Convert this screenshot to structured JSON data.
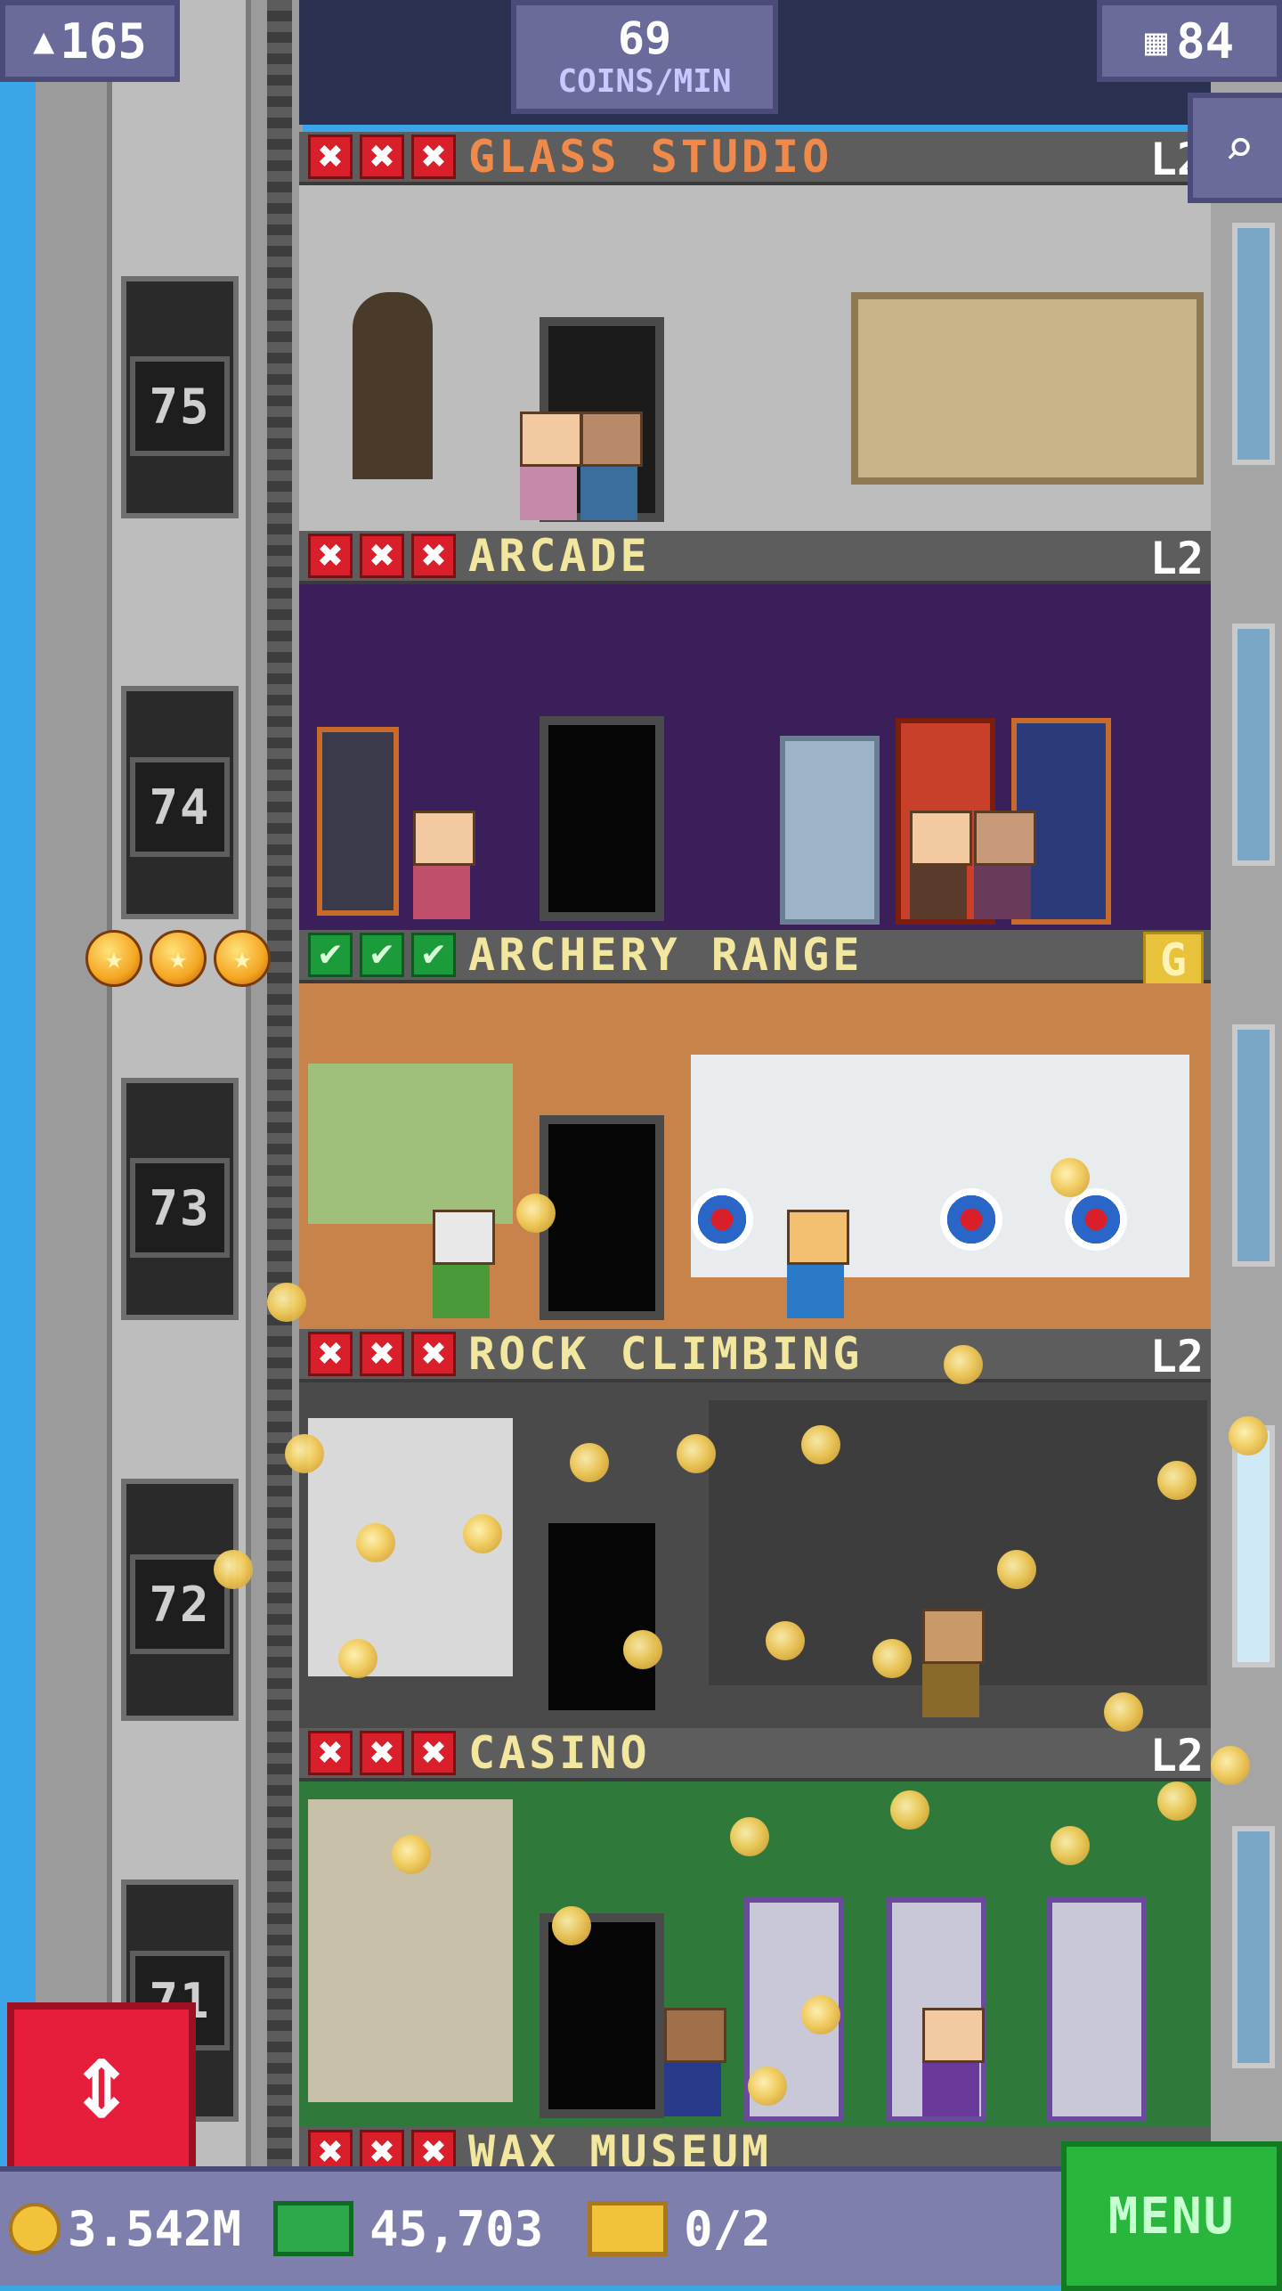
{
  "top": {
    "population": "165",
    "coins_per_min_value": "69",
    "coins_per_min_unit": "COINS/MIN",
    "floor_count": "84"
  },
  "elevator_floors": [
    "75",
    "74",
    "73",
    "72",
    "71"
  ],
  "floors": [
    {
      "name": "GLASS STUDIO",
      "level": "L2",
      "status": "unstocked"
    },
    {
      "name": "ARCADE",
      "level": "L2",
      "status": "unstocked"
    },
    {
      "name": "ARCHERY RANGE",
      "level": "G",
      "status": "stocked"
    },
    {
      "name": "ROCK CLIMBING",
      "level": "L2",
      "status": "unstocked"
    },
    {
      "name": "CASINO",
      "level": "L2",
      "status": "unstocked"
    },
    {
      "name": "WAX MUSEUM",
      "level": "",
      "status": "unstocked"
    }
  ],
  "stars": [
    "★",
    "★",
    "★"
  ],
  "bottom": {
    "coins": "3.542M",
    "bux": "45,703",
    "tickets": "0/2",
    "menu_label": "MENU"
  },
  "icons": {
    "population": "person-icon",
    "floor_count": "building-icon",
    "search": "magnifier-icon",
    "elevator": "up-down-arrows-icon",
    "coin": "coin-icon",
    "bux": "bux-bill-icon",
    "ticket": "ticket-icon"
  },
  "colors": {
    "sky": "#3aa6e8",
    "menu_green": "#28b63c",
    "elevator_red": "#e61e3c",
    "hud_purple": "#6a6a9b"
  }
}
